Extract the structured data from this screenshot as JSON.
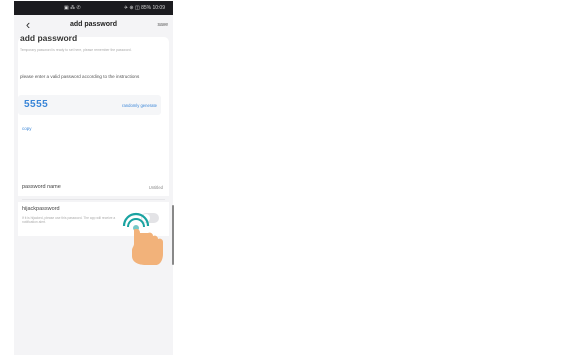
{
  "statusbar": {
    "left_text": "▣ ⁂ ✆ ",
    "right_text": "✈ ⊕ ◫ 85% 10:09"
  },
  "appbar": {
    "title": "add password",
    "save_label": "save"
  },
  "form": {
    "heading": "add password",
    "hint": "Temporary password is ready to set here, please remember the password.",
    "instruction": "please enter a valid password according to the instructions",
    "password_value": "5555",
    "randomly_generate_label": "randomly generate",
    "copy_label": "copy",
    "password_name_label": "password name",
    "password_name_value": "Untitled",
    "hijack_title": "hijackpassword",
    "hijack_description": "If it is hijacked, please use this password. The app will receive a notification alert."
  },
  "colors": {
    "accent": "#3a86d8",
    "status_bar": "#1b1b1f",
    "background": "#f4f4f6",
    "tap_hand": "#f2b27a",
    "tap_ring": "#1aa3a1"
  }
}
